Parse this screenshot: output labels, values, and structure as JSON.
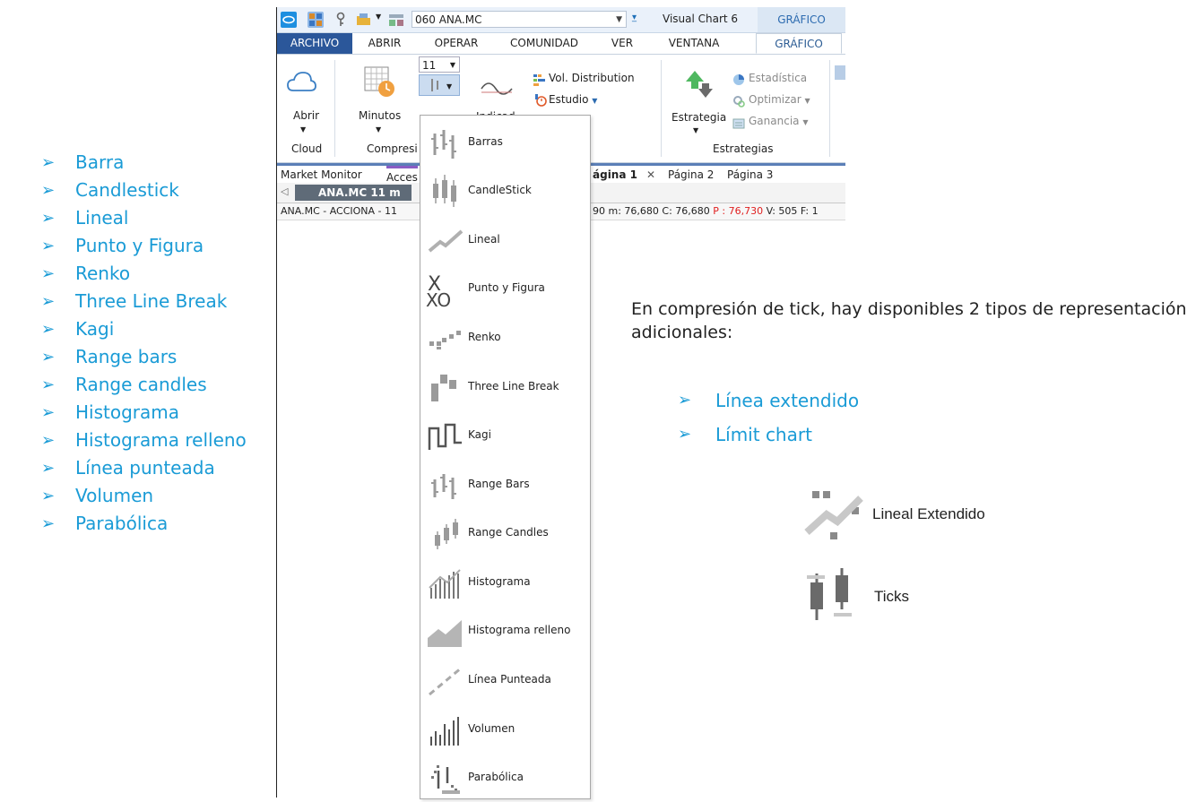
{
  "left_list": [
    "Barra",
    "Candlestick",
    "Lineal",
    "Punto y Figura",
    "Renko",
    "Three Line Break",
    "Kagi",
    "Range bars",
    "Range candles",
    "Histograma",
    "Histograma relleno",
    "Línea punteada",
    "Volumen",
    "Parabólica"
  ],
  "qat": {
    "symbol": "060 ANA.MC",
    "title": "Visual Chart 6",
    "context_tab": "GRÁFICO"
  },
  "tabs": [
    {
      "label": "ARCHIVO"
    },
    {
      "label": "ABRIR"
    },
    {
      "label": "OPERAR"
    },
    {
      "label": "COMUNIDAD"
    },
    {
      "label": "VER"
    },
    {
      "label": "VENTANA"
    },
    {
      "label": "GRÁFICO"
    }
  ],
  "ribbon": {
    "abrir": "Abrir",
    "minutos": "Minutos",
    "compression_value": "11",
    "indicator_partial": "Indicad",
    "vol_distribution": "Vol. Distribution",
    "estudio": "Estudio",
    "estrategia": "Estrategia",
    "estadistica": "Estadística",
    "optimizar": "Optimizar",
    "ganancia": "Ganancia",
    "groups": {
      "cloud": "Cloud",
      "compresion": "Compresi",
      "estrategias": "Estrategias"
    }
  },
  "panels": {
    "market_monitor": "Market Monitor",
    "acces": "Acces",
    "pagina1": "ágina 1",
    "pagina2": "Página 2",
    "pagina3": "Página 3"
  },
  "sheet_tab": "ANA.MC 11 m",
  "infobar": {
    "left": "ANA.MC - ACCIONA - 11",
    "right": "90  m: 76,680  C: 76,680 ",
    "p": "P : 76,730",
    "tail": " V: 505  F: 1"
  },
  "menu_items": [
    "Barras",
    "CandleStick",
    "Lineal",
    "Punto y Figura",
    "Renko",
    "Three Line Break",
    "Kagi",
    "Range Bars",
    "Range Candles",
    "Histograma",
    "Histograma relleno",
    "Línea Punteada",
    "Volumen",
    "Parabólica"
  ],
  "desc": "En compresión de tick, hay disponibles  2 tipos de representación adicionales:",
  "right_list": [
    "Línea extendido",
    "Límit chart"
  ],
  "extras": {
    "lineal_extendido": "Lineal Extendido",
    "ticks": "Ticks"
  },
  "colors": {
    "accent": "#1a9bd6",
    "file_tab": "#2b579a",
    "icon_gray": "#9a9a9a",
    "price_red": "#e02020"
  }
}
